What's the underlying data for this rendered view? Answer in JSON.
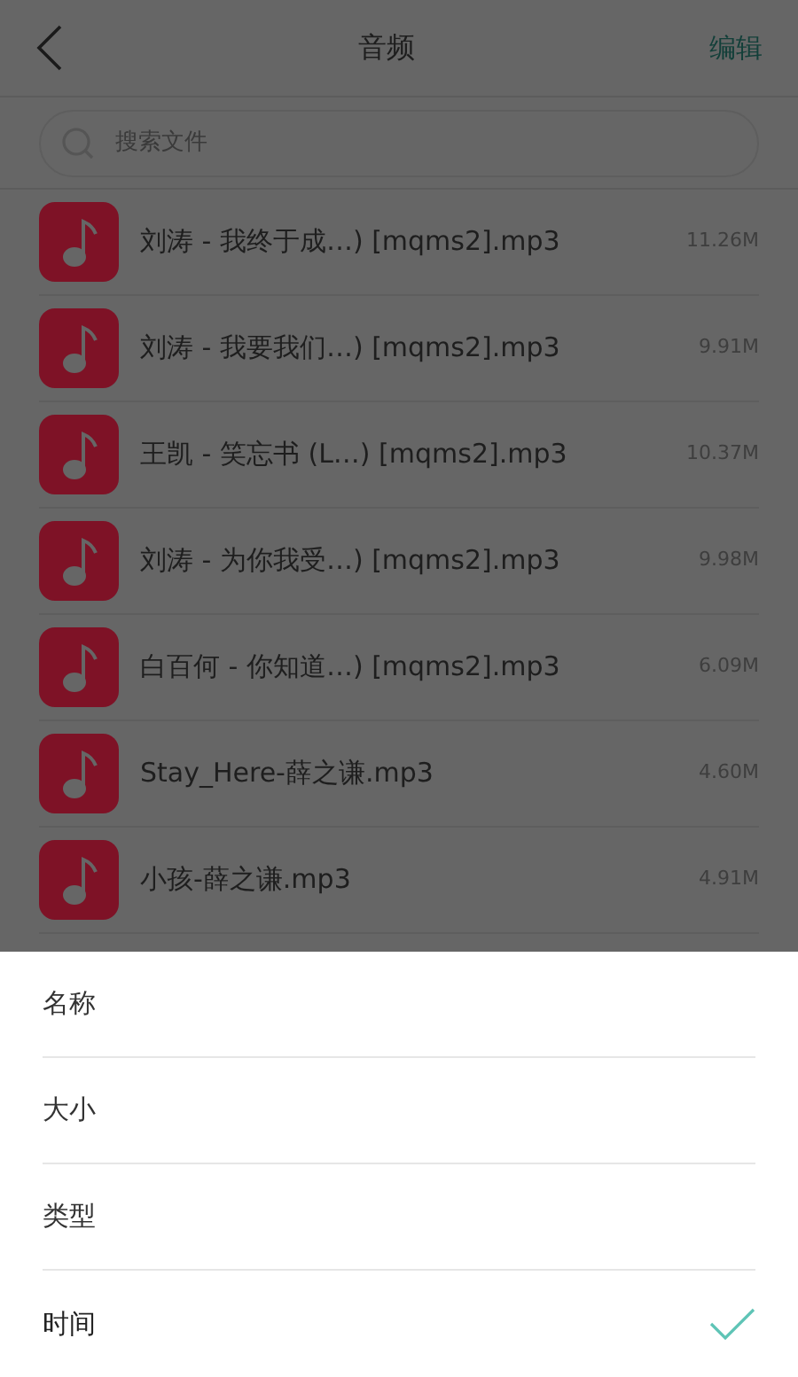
{
  "header": {
    "title": "音频",
    "action": "编辑"
  },
  "search": {
    "placeholder": "搜索文件"
  },
  "files": [
    {
      "name": "刘涛 - 我终于成…) [mqms2].mp3",
      "size": "11.26M"
    },
    {
      "name": "刘涛 - 我要我们…) [mqms2].mp3",
      "size": "9.91M"
    },
    {
      "name": "王凯 - 笑忘书 (L…) [mqms2].mp3",
      "size": "10.37M"
    },
    {
      "name": "刘涛 - 为你我受…) [mqms2].mp3",
      "size": "9.98M"
    },
    {
      "name": "白百何 - 你知道…) [mqms2].mp3",
      "size": "6.09M"
    },
    {
      "name": "Stay_Here-薛之谦.mp3",
      "size": "4.60M"
    },
    {
      "name": "小孩-薛之谦.mp3",
      "size": "4.91M"
    }
  ],
  "sort_menu": [
    {
      "label": "名称",
      "selected": false
    },
    {
      "label": "大小",
      "selected": false
    },
    {
      "label": "类型",
      "selected": false
    },
    {
      "label": "时间",
      "selected": true
    }
  ]
}
